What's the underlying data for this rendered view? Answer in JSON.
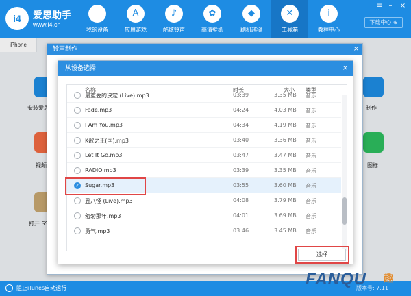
{
  "app": {
    "name": "爱思助手",
    "url": "www.i4.cn",
    "logo_text": "i4"
  },
  "nav": [
    {
      "label": "我的设备",
      "icon": "apple-icon",
      "glyph": ""
    },
    {
      "label": "应用游戏",
      "icon": "app-store-icon",
      "glyph": "A"
    },
    {
      "label": "酷炫铃声",
      "icon": "bell-icon",
      "glyph": "♪"
    },
    {
      "label": "高清壁纸",
      "icon": "flower-icon",
      "glyph": "✿"
    },
    {
      "label": "刷机越狱",
      "icon": "box-icon",
      "glyph": "◆"
    },
    {
      "label": "工具箱",
      "icon": "tools-icon",
      "glyph": "✕"
    },
    {
      "label": "教程中心",
      "icon": "info-icon",
      "glyph": "i"
    }
  ],
  "download_center": "下载中心 ⊕",
  "device_tab": "iPhone",
  "background_tools": [
    {
      "label": "安装爱思",
      "icon": "i4-install-icon",
      "color": "#1e8ce3"
    },
    {
      "label": "视频",
      "icon": "video-icon",
      "color": "#f06a42"
    },
    {
      "label": "打开 SS",
      "icon": "ssh-icon",
      "color": "#c7a670"
    },
    {
      "label": "制作",
      "icon": "ringtone-make-icon",
      "color": "#1e8ce3"
    },
    {
      "label": "图标",
      "icon": "icon-manage-icon",
      "color": "#2dbd5f"
    }
  ],
  "outer_dialog": {
    "title": "铃声制作"
  },
  "inner_dialog": {
    "title": "从设备选择"
  },
  "columns": {
    "name": "名称",
    "duration": "时长",
    "size": "大小",
    "type": "类型"
  },
  "files": [
    {
      "name": "最重要的决定 (Live).mp3",
      "duration": "03:39",
      "size": "3.35 MB",
      "type": "音乐",
      "selected": false
    },
    {
      "name": "Fade.mp3",
      "duration": "04:24",
      "size": "4.03 MB",
      "type": "音乐",
      "selected": false
    },
    {
      "name": "I Am You.mp3",
      "duration": "04:34",
      "size": "4.19 MB",
      "type": "音乐",
      "selected": false
    },
    {
      "name": "K歌之王(国).mp3",
      "duration": "03:40",
      "size": "3.36 MB",
      "type": "音乐",
      "selected": false
    },
    {
      "name": "Let It Go.mp3",
      "duration": "03:47",
      "size": "3.47 MB",
      "type": "音乐",
      "selected": false
    },
    {
      "name": "RADIO.mp3",
      "duration": "03:39",
      "size": "3.35 MB",
      "type": "音乐",
      "selected": false
    },
    {
      "name": "Sugar.mp3",
      "duration": "03:55",
      "size": "3.60 MB",
      "type": "音乐",
      "selected": true
    },
    {
      "name": "丑八怪 (Live).mp3",
      "duration": "04:08",
      "size": "3.79 MB",
      "type": "音乐",
      "selected": false
    },
    {
      "name": "匆匆那年.mp3",
      "duration": "04:01",
      "size": "3.69 MB",
      "type": "音乐",
      "selected": false
    },
    {
      "name": "勇气.mp3",
      "duration": "03:46",
      "size": "3.45 MB",
      "type": "音乐",
      "selected": false
    }
  ],
  "select_button": "选择",
  "status": {
    "text": "阻止iTunes自动运行",
    "version": "版本号: 7.11"
  },
  "watermark": {
    "text": "FANQU",
    "cn": "趣"
  },
  "colors": {
    "brand_blue": "#1e8ce3",
    "highlight_red": "#e04646",
    "selected_row": "#e5f1fc"
  }
}
